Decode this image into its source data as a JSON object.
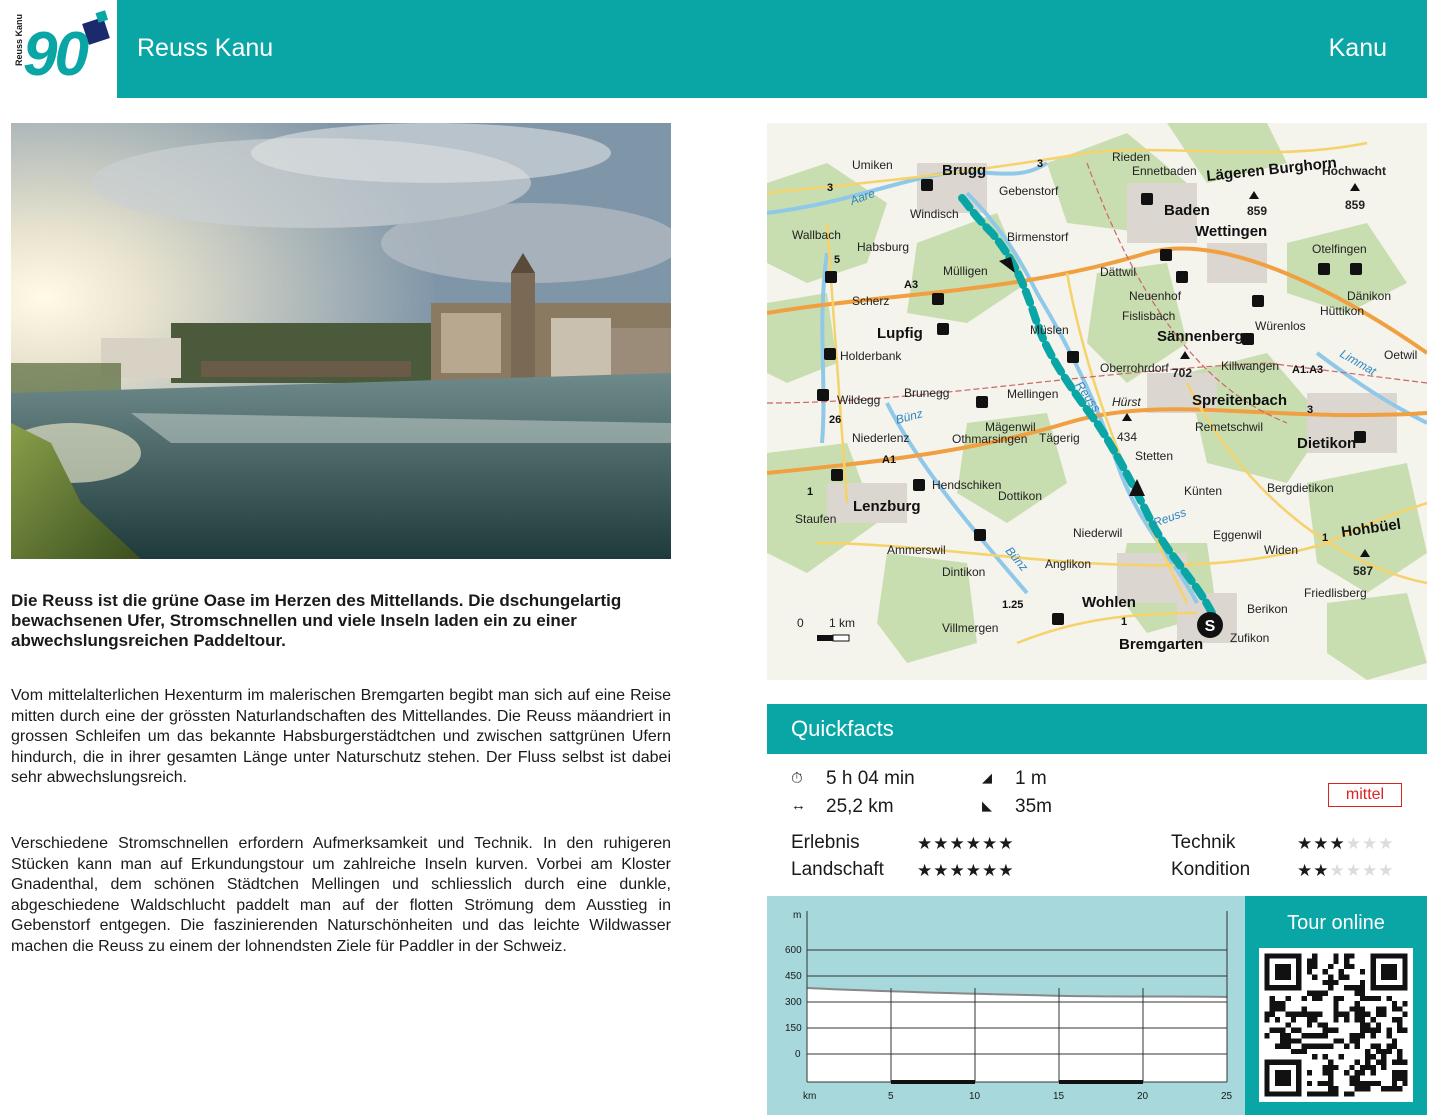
{
  "header": {
    "number": "90",
    "logo_text": "Reuss Kanu",
    "title": "Reuss Kanu",
    "category": "Kanu",
    "accent_color": "#0aa6a6"
  },
  "photo": {
    "alt_semantic": "river-town-photo"
  },
  "lead": "Die Reuss ist die grüne Oase im Herzen des Mittellands. Die dschun­gelartig bewachsenen Ufer, Stromschnellen und viele Inseln laden ein zu einer abwechslungsreichen Paddeltour.",
  "body": [
    "Vom mittelalterlichen Hexenturm im malerischen Bremgarten begibt man sich auf eine Reise mitten durch eine der grössten Naturlandschaften des Mittellan­des. Die Reuss mäandriert in grossen Schleifen um das bekannte Habsburger­städtchen und zwischen sattgrünen Ufern hindurch, die in ihrer gesamten Län­ge unter Naturschutz stehen. Der Fluss selbst ist dabei sehr abwechslungsreich.",
    "Verschiedene Stromschnellen erfordern Aufmerksamkeit und Technik. In den ruhigeren Stücken kann man auf Erkundungstour um zahlreiche Inseln kurven. Vorbei am Kloster Gnadenthal, dem schönen Städtchen Mellingen und schliess­lich durch eine dunkle, abgeschiedene Waldschlucht paddelt man auf der flotten Strömung dem Ausstieg in Gebenstorf entgegen. Die faszinierenden Naturschönheiten und das leichte Wildwasser machen die Reuss zu einem der lohnendsten Ziele für Paddler in der Schweiz."
  ],
  "map": {
    "places": [
      "Umiken",
      "Brugg",
      "Gebenstorf",
      "Windisch",
      "Rieden",
      "Ennetbaden",
      "Lägeren Burghorn",
      "Hochwacht",
      "Baden",
      "Wettingen",
      "Wallbach",
      "Habsburg",
      "Birmenstorf",
      "Otelfingen",
      "Mülligen",
      "Dättwil",
      "Scherz",
      "Neuenhof",
      "Dänikon",
      "Lupfig",
      "Fislisbach",
      "Sännenberg",
      "Würenlos",
      "Hüttikon",
      "Müslen",
      "Holderbank",
      "Oberrohrdorf",
      "Killwangen",
      "Oetwil",
      "Brunegg",
      "Mellingen",
      "Hürst",
      "Spreitenbach",
      "Wildegg",
      "Mägenwil",
      "Remetschwil",
      "Niederlenz",
      "Othmarsingen",
      "Tägerig",
      "Dietikon",
      "Stetten",
      "Hendschiken",
      "Dottikon",
      "Künten",
      "Bergdietikon",
      "Staufen",
      "Lenzburg",
      "Niederwil",
      "Eggenwil",
      "Hohbüel",
      "Ammerswil",
      "Widen",
      "Anglikon",
      "Dintikon",
      "Friedlisberg",
      "Wohlen",
      "Berikon",
      "Villmergen",
      "Bremgarten",
      "Zufikon"
    ],
    "peaks": [
      "859",
      "859",
      "702",
      "434",
      "587"
    ],
    "rivers": [
      "Aare",
      "Reuss",
      "Bünz",
      "Limmat"
    ],
    "roads": [
      "3",
      "A3",
      "5",
      "A1",
      "1",
      "26",
      "1.25",
      "A1.A3"
    ],
    "scale_zero": "0",
    "scale_label": "1 km",
    "start_marker": "S"
  },
  "quickfacts": {
    "title": "Quickfacts",
    "duration": "5 h 04 min",
    "distance": "25,2 km",
    "ascent": "1 m",
    "descent": "35m",
    "difficulty": "mittel",
    "ratings": [
      {
        "label": "Erlebnis",
        "value": 6,
        "max": 6
      },
      {
        "label": "Landschaft",
        "value": 6,
        "max": 6
      },
      {
        "label": "Technik",
        "value": 3,
        "max": 6
      },
      {
        "label": "Kondition",
        "value": 2,
        "max": 6
      }
    ],
    "icons": {
      "duration": "clock-icon",
      "distance": "arrows-horizontal-icon",
      "ascent": "ascent-icon",
      "descent": "descent-icon"
    }
  },
  "profile": {
    "unit_y": "m",
    "unit_x": "km",
    "y_ticks": [
      "600",
      "450",
      "300",
      "150",
      "0"
    ],
    "x_ticks": [
      "5",
      "10",
      "15",
      "20",
      "25"
    ]
  },
  "online": {
    "title": "Tour online"
  }
}
